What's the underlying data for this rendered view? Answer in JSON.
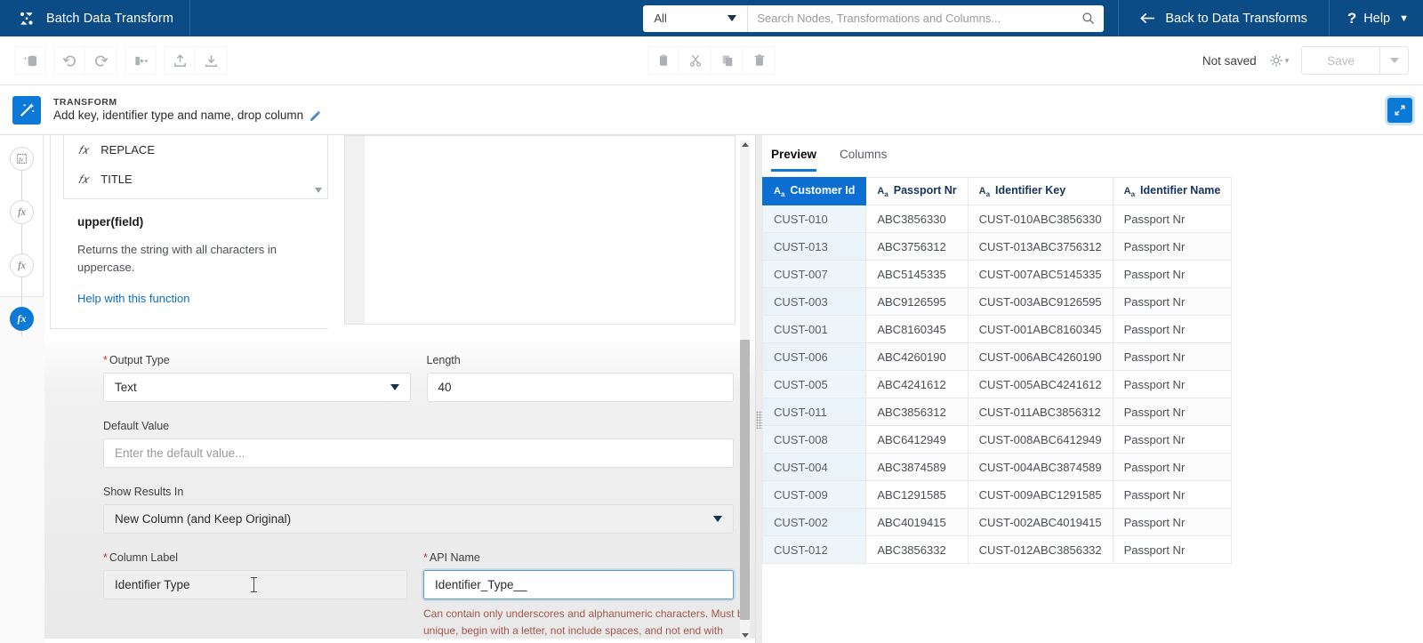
{
  "header": {
    "brand_icon": "batch-transform-logo-icon",
    "brand_title": "Batch Data Transform",
    "search_scope": "All",
    "search_placeholder": "Search Nodes, Transformations and Columns...",
    "search_value": "",
    "back_label": "Back to Data Transforms",
    "help_label": "Help",
    "bg_color": "#0b4b86"
  },
  "toolbar": {
    "left_icons": [
      "add-dataset-icon",
      "undo-icon",
      "redo-icon",
      "run-flow-icon",
      "upload-icon",
      "download-icon"
    ],
    "center_icons": [
      "paste-icon",
      "cut-icon",
      "copy-icon",
      "delete-icon"
    ],
    "status": "Not saved",
    "settings_icon": "gear-icon",
    "save_label": "Save",
    "save_caret_icon": "chevron-down-icon"
  },
  "transform_bar": {
    "icon": "magic-wand-icon",
    "kicker": "TRANSFORM",
    "name": "Add key, identifier type and name, drop column",
    "edit_icon": "pencil-icon",
    "expand_icon": "expand-diagonal-icon",
    "accent_color": "#0d79d6"
  },
  "rail": {
    "nodes": [
      {
        "icon": "data-source-icon",
        "label": "",
        "active": false
      },
      {
        "icon": "formula-icon",
        "label": "fx",
        "active": false
      },
      {
        "icon": "formula-icon",
        "label": "fx",
        "active": false
      },
      {
        "icon": "formula-icon",
        "label": "fx",
        "active": true
      }
    ]
  },
  "function_panel": {
    "list": [
      {
        "icon": "fx-icon",
        "name": "REPLACE"
      },
      {
        "icon": "fx-icon",
        "name": "TITLE"
      }
    ],
    "scroll_icon": "chevron-down-icon",
    "doc_signature": "upper(field)",
    "doc_description": "Returns the string with all characters in uppercase.",
    "doc_link": "Help with this function"
  },
  "form": {
    "output_type": {
      "label": "Output Type",
      "required": true,
      "value": "Text"
    },
    "length": {
      "label": "Length",
      "required": false,
      "value": "40"
    },
    "default_value": {
      "label": "Default Value",
      "required": false,
      "value": "",
      "placeholder": "Enter the default value..."
    },
    "show_results_in": {
      "label": "Show Results In",
      "required": false,
      "value": "New Column (and Keep Original)"
    },
    "column_label": {
      "label": "Column Label",
      "required": true,
      "value": "Identifier Type"
    },
    "api_name": {
      "label": "API Name",
      "required": true,
      "value": "Identifier_Type__",
      "error": "Can contain only underscores and alphanumeric characters. Must be unique, begin with a letter, not include spaces, and not end with"
    }
  },
  "preview": {
    "tabs": [
      {
        "label": "Preview",
        "active": true
      },
      {
        "label": "Columns",
        "active": false
      }
    ],
    "type_icon": "text-type-icon",
    "columns": [
      "Customer Id",
      "Passport Nr",
      "Identifier Key",
      "Identifier Name"
    ],
    "selected_column_index": 0,
    "rows": [
      [
        "CUST-010",
        "ABC3856330",
        "CUST-010ABC3856330",
        "Passport Nr"
      ],
      [
        "CUST-013",
        "ABC3756312",
        "CUST-013ABC3756312",
        "Passport Nr"
      ],
      [
        "CUST-007",
        "ABC5145335",
        "CUST-007ABC5145335",
        "Passport Nr"
      ],
      [
        "CUST-003",
        "ABC9126595",
        "CUST-003ABC9126595",
        "Passport Nr"
      ],
      [
        "CUST-001",
        "ABC8160345",
        "CUST-001ABC8160345",
        "Passport Nr"
      ],
      [
        "CUST-006",
        "ABC4260190",
        "CUST-006ABC4260190",
        "Passport Nr"
      ],
      [
        "CUST-005",
        "ABC4241612",
        "CUST-005ABC4241612",
        "Passport Nr"
      ],
      [
        "CUST-011",
        "ABC3856312",
        "CUST-011ABC3856312",
        "Passport Nr"
      ],
      [
        "CUST-008",
        "ABC6412949",
        "CUST-008ABC6412949",
        "Passport Nr"
      ],
      [
        "CUST-004",
        "ABC3874589",
        "CUST-004ABC3874589",
        "Passport Nr"
      ],
      [
        "CUST-009",
        "ABC1291585",
        "CUST-009ABC1291585",
        "Passport Nr"
      ],
      [
        "CUST-002",
        "ABC4019415",
        "CUST-002ABC4019415",
        "Passport Nr"
      ],
      [
        "CUST-012",
        "ABC3856332",
        "CUST-012ABC3856332",
        "Passport Nr"
      ]
    ]
  }
}
